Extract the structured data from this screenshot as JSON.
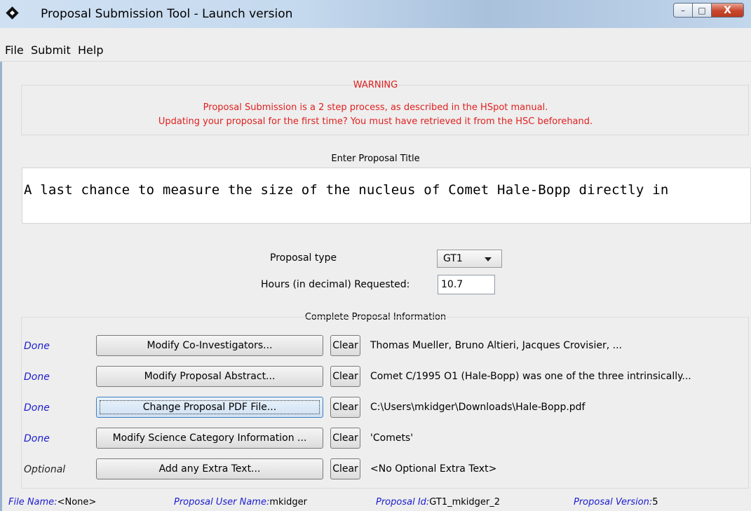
{
  "window": {
    "title": "Proposal Submission Tool - Launch version",
    "controls": {
      "minimize": "–",
      "maximize": "□",
      "close": "X"
    }
  },
  "menu": {
    "file": "File",
    "submit": "Submit",
    "help": "Help"
  },
  "warning": {
    "title": "WARNING",
    "line1": "Proposal Submission is a 2 step process, as described in the HSpot manual.",
    "line2": "Updating your proposal for the first time? You must have retrieved it from the HSC beforehand."
  },
  "proposal_title": {
    "label": "Enter Proposal Title",
    "value": "A last chance to measure the size of the nucleus of Comet Hale-Bopp directly in"
  },
  "proposal_type": {
    "label": "Proposal type",
    "value": "GT1"
  },
  "hours": {
    "label": "Hours (in decimal) Requested:",
    "value": "10.7"
  },
  "complete_info": {
    "label": "Complete Proposal Information",
    "clear_label": "Clear",
    "rows": [
      {
        "status": "Done",
        "button": "Modify Co-Investigators...",
        "info": "Thomas Mueller, Bruno Altieri, Jacques Crovisier, ..."
      },
      {
        "status": "Done",
        "button": "Modify Proposal Abstract...",
        "info": "Comet C/1995 O1 (Hale-Bopp) was one of the three intrinsically..."
      },
      {
        "status": "Done",
        "button": "Change Proposal PDF File...",
        "info": "C:\\Users\\mkidger\\Downloads\\Hale-Bopp.pdf"
      },
      {
        "status": "Done",
        "button": "Modify Science Category Information ...",
        "info": "'Comets'"
      },
      {
        "status": "Optional",
        "button": "Add any Extra Text...",
        "info": "<No Optional Extra Text>"
      }
    ]
  },
  "statusbar": {
    "file_name_label": "File Name:",
    "file_name": "<None>",
    "user_label": "Proposal User Name:",
    "user": "mkidger",
    "id_label": "Proposal Id:",
    "id": "GT1_mkidger_2",
    "version_label": "Proposal Version:",
    "version": "5"
  }
}
